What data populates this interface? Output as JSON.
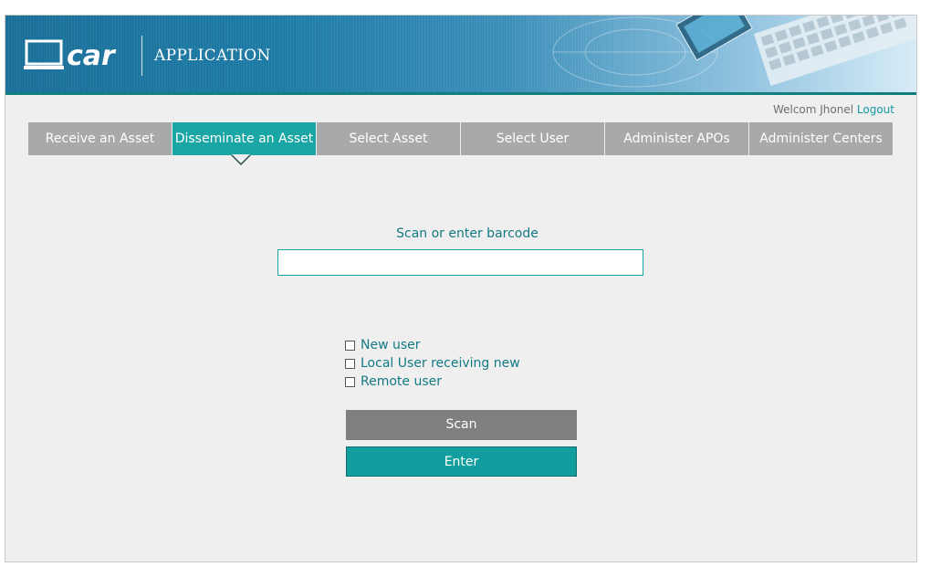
{
  "header": {
    "logo_text": "car",
    "app_label": "APPLICATION"
  },
  "user": {
    "welcome": "Welcom Jhonel",
    "logout": "Logout"
  },
  "tabs": [
    {
      "label": "Receive an Asset",
      "active": false
    },
    {
      "label": "Disseminate an Asset",
      "active": true
    },
    {
      "label": "Select Asset",
      "active": false
    },
    {
      "label": "Select User",
      "active": false
    },
    {
      "label": "Administer APOs",
      "active": false
    },
    {
      "label": "Administer Centers",
      "active": false
    }
  ],
  "barcode": {
    "label": "Scan or enter barcode",
    "value": "",
    "placeholder": ""
  },
  "options": [
    {
      "label": "New user",
      "checked": false
    },
    {
      "label": "Local User receiving new",
      "checked": false
    },
    {
      "label": "Remote user",
      "checked": false
    }
  ],
  "buttons": {
    "scan": "Scan",
    "enter": "Enter"
  },
  "colors": {
    "accent": "#1aa6a4",
    "tab_inactive": "#a9a9a9",
    "scan_button": "#7f7f7f",
    "text_teal": "#137a84"
  }
}
